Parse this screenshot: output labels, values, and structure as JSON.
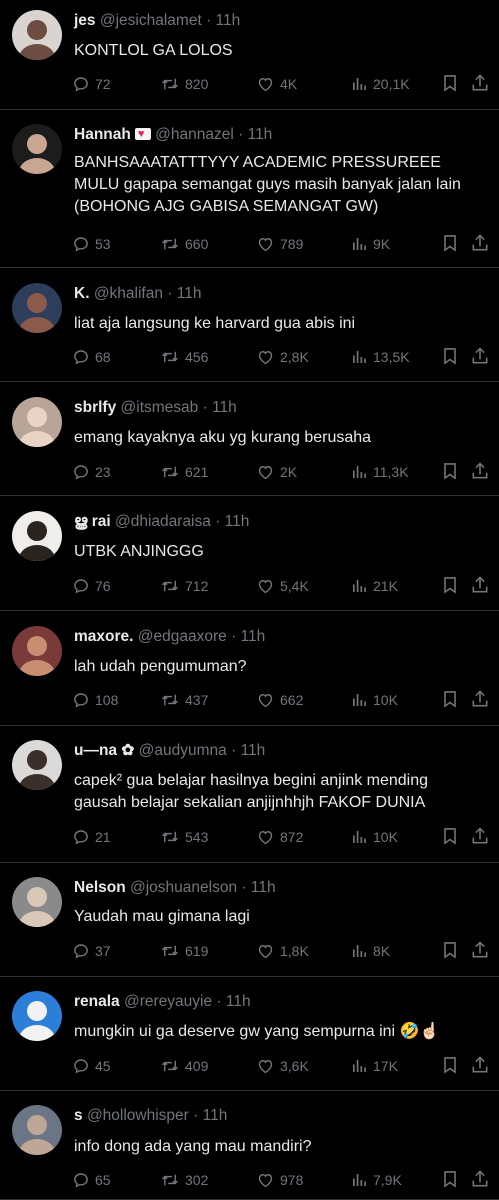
{
  "colors": {
    "background": "#000000",
    "text": "#e7e9ea",
    "muted": "#71767b",
    "divider": "#2f3336"
  },
  "icons": {
    "reply": "reply-icon",
    "retweet": "retweet-icon",
    "like": "heart-icon",
    "views": "views-icon",
    "bookmark": "bookmark-icon",
    "share": "share-icon"
  },
  "tweets": [
    {
      "name": "jes",
      "handle": "@jesichalamet",
      "time": "11h",
      "text": "KONTLOL GA LOLOS",
      "replies": "72",
      "retweets": "820",
      "likes": "4K",
      "views": "20,1K"
    },
    {
      "name": "Hannah",
      "handle": "@hannazel",
      "time": "11h",
      "text": "BANHSAAATATTTYYY ACADEMIC PRESSUREEE MULU gapapa semangat guys masih banyak jalan lain (BOHONG AJG GABISA SEMANGAT GW)",
      "replies": "53",
      "retweets": "660",
      "likes": "789",
      "views": "9K"
    },
    {
      "name": "K.",
      "handle": "@khalifan",
      "time": "11h",
      "text": "liat aja langsung ke harvard gua abis ini",
      "replies": "68",
      "retweets": "456",
      "likes": "2,8K",
      "views": "13,5K"
    },
    {
      "name": "sbrlfy",
      "handle": "@itsmesab",
      "time": "11h",
      "text": "emang kayaknya aku yg kurang berusaha",
      "replies": "23",
      "retweets": "621",
      "likes": "2K",
      "views": "11,3K"
    },
    {
      "name": "ൠ rai",
      "handle": "@dhiadaraisa",
      "time": "11h",
      "text": "UTBK ANJINGGG",
      "replies": "76",
      "retweets": "712",
      "likes": "5,4K",
      "views": "21K"
    },
    {
      "name": "maxore.",
      "handle": "@edgaaxore",
      "time": "11h",
      "text": "lah udah pengumuman?",
      "replies": "108",
      "retweets": "437",
      "likes": "662",
      "views": "10K"
    },
    {
      "name": "u—na ✿",
      "handle": "@audyumna",
      "time": "11h",
      "text": "capek² gua belajar hasilnya begini anjink mending gausah belajar sekalian anjijnhhjh FAKOF DUNIA",
      "replies": "21",
      "retweets": "543",
      "likes": "872",
      "views": "10K"
    },
    {
      "name": "Nelson",
      "handle": "@joshuanelson",
      "time": "11h",
      "text": "Yaudah mau gimana lagi",
      "replies": "37",
      "retweets": "619",
      "likes": "1,8K",
      "views": "8K"
    },
    {
      "name": "renala",
      "handle": "@rereyauyie",
      "time": "11h",
      "text": "mungkin ui ga deserve gw yang sempurna ini 🤣☝🏻",
      "replies": "45",
      "retweets": "409",
      "likes": "3,6K",
      "views": "17K"
    },
    {
      "name": "s",
      "handle": "@hollowhisper",
      "time": "11h",
      "text": "info dong ada yang mau mandiri?",
      "replies": "65",
      "retweets": "302",
      "likes": "978",
      "views": "7,9K"
    }
  ]
}
